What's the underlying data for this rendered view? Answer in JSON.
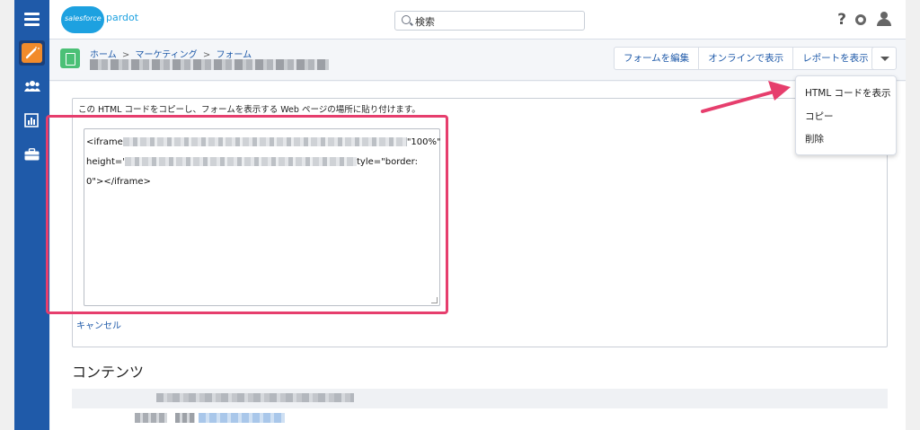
{
  "colors": {
    "rail": "#1f5aa9",
    "accent": "#f28b2b",
    "link": "#1f5aa9",
    "highlight": "#e63e6d",
    "form_icon": "#4bc076",
    "logo": "#1da1e0"
  },
  "header": {
    "logo_cloud_text": "salesforce",
    "logo_product": "pardot",
    "search_placeholder": "検索",
    "help_label": "?",
    "icons": [
      "menu-icon",
      "search-icon",
      "help-icon",
      "gear-icon",
      "user-icon"
    ]
  },
  "sidebar": {
    "items": [
      {
        "name": "marketing",
        "icon": "wand-icon",
        "active": true
      },
      {
        "name": "prospects",
        "icon": "users-icon",
        "active": false
      },
      {
        "name": "reports",
        "icon": "bar-chart-icon",
        "active": false
      },
      {
        "name": "admin",
        "icon": "briefcase-icon",
        "active": false
      }
    ]
  },
  "breadcrumb": {
    "items": [
      "ホーム",
      "マーケティング",
      "フォーム"
    ],
    "separator": ">"
  },
  "toolbar": {
    "buttons": [
      "フォームを編集",
      "オンラインで表示",
      "レポートを表示"
    ]
  },
  "dropdown": {
    "items": [
      "HTML コードを表示",
      "コピー",
      "削除"
    ]
  },
  "html_panel": {
    "instruction": "この HTML コードをコピーし、フォームを表示する Web ページの場所に貼り付けます。",
    "code_line1_start": "<iframe",
    "code_line1_end": "\"100%\"",
    "code_line2_start": "height='",
    "code_line2_end": "tyle=\"border:",
    "code_line3": "0\"></iframe>",
    "cancel_label": "キャンセル"
  },
  "contents": {
    "title": "コンテンツ"
  }
}
